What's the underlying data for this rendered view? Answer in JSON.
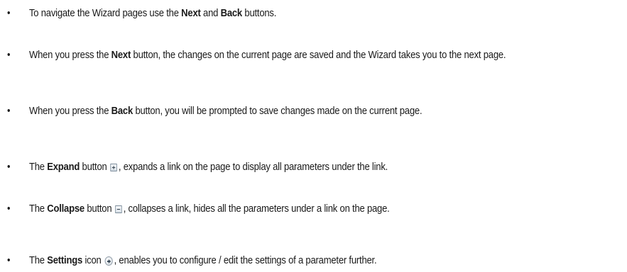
{
  "bullet_glyph": "•",
  "items": [
    {
      "pre": "To navigate the Wizard pages use the ",
      "b1": "Next",
      "mid": " and ",
      "b2": "Back",
      "post": " buttons."
    },
    {
      "pre": "When you press the ",
      "b1": "Next",
      "post": " button, the changes on the current page are saved and the Wizard takes you to the next page."
    },
    {
      "pre": "When you press the ",
      "b1": "Back",
      "post": " button, you will be prompted to save changes made on the current page."
    },
    {
      "pre": "The ",
      "b1": "Expand",
      "mid": " button ",
      "icon": "expand-icon",
      "post": ", expands a link on the page to display all parameters under the link."
    },
    {
      "pre": "The ",
      "b1": "Collapse",
      "mid": " button ",
      "icon": "collapse-icon",
      "post": ", collapses a link, hides all the parameters under a link on the page."
    },
    {
      "pre": "The ",
      "b1": "Settings",
      "mid": " icon ",
      "icon": "settings-arrow-icon",
      "post": ", enables you to configure / edit the settings of a parameter further."
    }
  ]
}
